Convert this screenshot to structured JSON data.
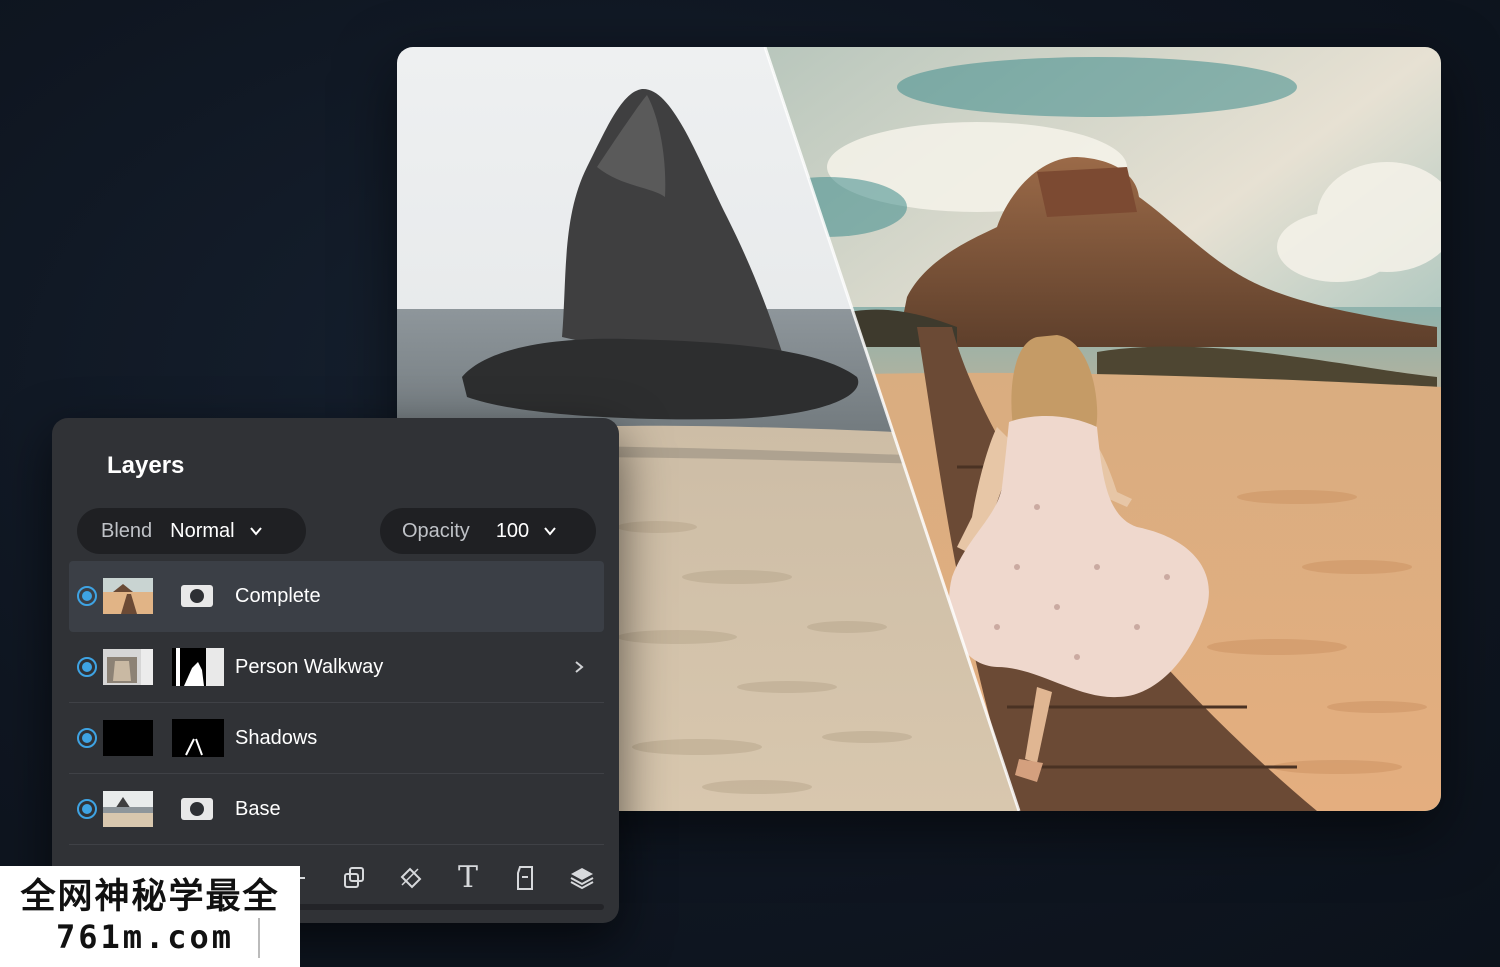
{
  "panel": {
    "title": "Layers",
    "blend": {
      "label": "Blend",
      "value": "Normal"
    },
    "opacity": {
      "label": "Opacity",
      "value": "100"
    },
    "layers": [
      {
        "name": "Complete",
        "visible": true,
        "selected": true
      },
      {
        "name": "Person Walkway",
        "visible": true,
        "selected": false,
        "has_children": true
      },
      {
        "name": "Shadows",
        "visible": true,
        "selected": false
      },
      {
        "name": "Base",
        "visible": true,
        "selected": false
      }
    ],
    "toolbar": [
      "add-icon",
      "duplicate-icon",
      "fill-icon",
      "text-icon",
      "new-file-icon",
      "layers-icon"
    ],
    "text_tool_glyph": "T"
  },
  "watermark": {
    "line1": "全网神秘学最全",
    "line2": "761m.com"
  },
  "colors": {
    "accent": "#3ea3e3",
    "panel_bg": "#303236",
    "pill_bg": "#1f2023",
    "stage_bg": "#0f1621"
  }
}
